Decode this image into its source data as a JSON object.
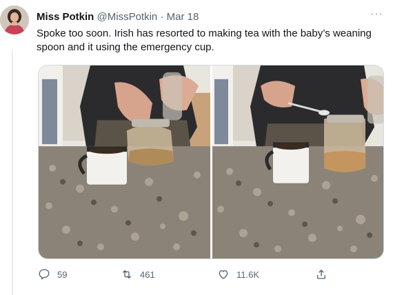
{
  "author": {
    "name": "Miss Potkin",
    "handle": "@MissPotkin",
    "separator": "·",
    "date": "Mar 18"
  },
  "menu": {
    "more_label": "···"
  },
  "tweet": {
    "text": "Spoke too soon. Irish has resorted to making tea with the baby’s weaning spoon and it using the emergency cup."
  },
  "actions": {
    "replies": "59",
    "retweets": "461",
    "likes": "11.6K"
  },
  "icons": {
    "reply": "reply-icon",
    "retweet": "retweet-icon",
    "like": "heart-icon",
    "share": "share-icon",
    "more": "more-icon"
  },
  "colors": {
    "text": "#0f1419",
    "secondary": "#536471",
    "border": "#cfd9de"
  }
}
